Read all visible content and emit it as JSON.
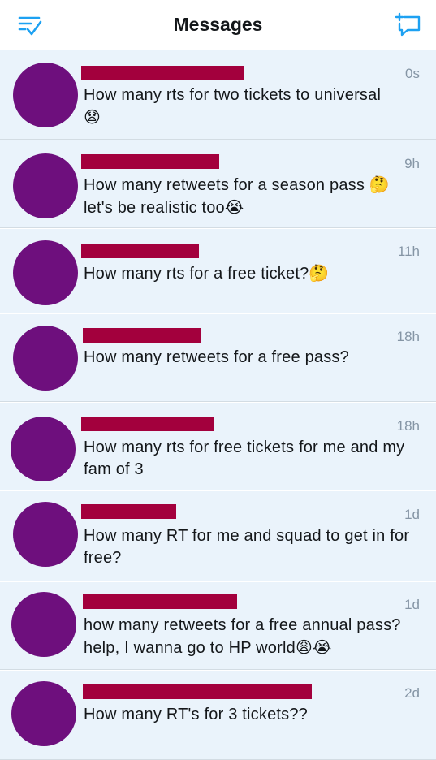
{
  "header": {
    "title": "Messages",
    "left_icon": "filter-checklist-icon",
    "right_icon": "compose-message-icon",
    "accent_color": "#1da1f2"
  },
  "colors": {
    "redaction": "#a3003d",
    "avatar": "#6e0f7d",
    "row_background": "#eaf3fb"
  },
  "messages": [
    {
      "time": "0s",
      "text": "How many rts for two tickets to universal",
      "emoji": "😧"
    },
    {
      "time": "9h",
      "text": "How many retweets for a season pass",
      "emoji": "🤔",
      "line2": "let's be realistic too",
      "emoji2": "😭"
    },
    {
      "time": "11h",
      "text": "How many rts for a free ticket?",
      "emoji": "🤔"
    },
    {
      "time": "18h",
      "text": "How many retweets for a free pass?"
    },
    {
      "time": "18h",
      "text": "How many rts for free tickets for me and my fam of 3"
    },
    {
      "time": "1d",
      "text": "How many RT for me and squad to get in for free?"
    },
    {
      "time": "1d",
      "text": "how many retweets for a free annual pass? help, I wanna go to HP world",
      "emoji": "😩😭"
    },
    {
      "time": "2d",
      "text": "How many RT's for 3 tickets??"
    }
  ]
}
